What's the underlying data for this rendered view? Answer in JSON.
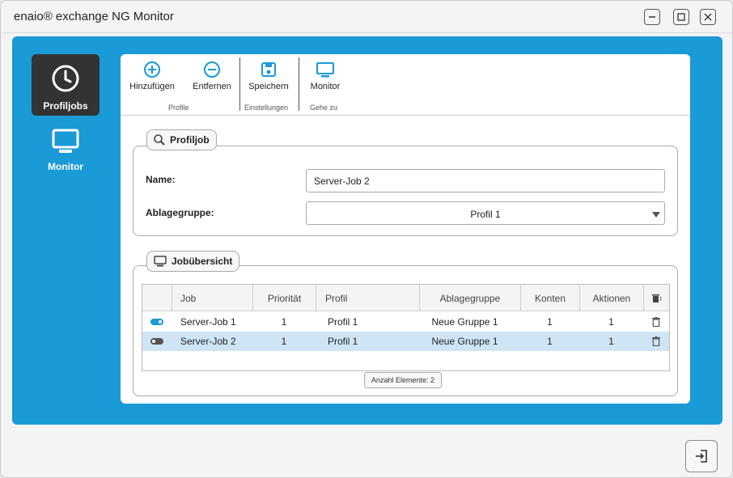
{
  "window": {
    "title": "enaio® exchange NG Monitor"
  },
  "colors": {
    "accent": "#1a9ad6",
    "nav_active": "#333333",
    "row_selected": "#cfe5f6"
  },
  "nav": [
    {
      "label": "Profiljobs",
      "icon": "clock-icon",
      "active": true
    },
    {
      "label": "Monitor",
      "icon": "monitor-icon",
      "active": false
    }
  ],
  "ribbon": {
    "buttons": [
      {
        "label": "Hinzufügen",
        "icon": "plus-circle-icon"
      },
      {
        "label": "Entfernen",
        "icon": "minus-circle-icon"
      },
      {
        "label": "Speichern",
        "icon": "save-icon"
      },
      {
        "label": "Monitor",
        "icon": "monitor-icon"
      }
    ],
    "groups": [
      "Profile",
      "Einstellungen",
      "Gehe zu"
    ]
  },
  "profiljob": {
    "title": "Profiljob",
    "name_label": "Name:",
    "name_value": "Server-Job 2",
    "ablagegruppe_label": "Ablagegruppe:",
    "ablagegruppe_value": "Profil 1"
  },
  "jobuebersicht": {
    "title": "Jobübersicht",
    "columns": [
      "Job",
      "Priorität",
      "Profil",
      "Ablagegruppe",
      "Konten",
      "Aktionen"
    ],
    "rows": [
      {
        "active": true,
        "job": "Server-Job 1",
        "prioritaet": "1",
        "profil": "Profil 1",
        "ablagegruppe": "Neue Gruppe 1",
        "konten": "1",
        "aktionen": "1",
        "selected": false
      },
      {
        "active": false,
        "job": "Server-Job 2",
        "prioritaet": "1",
        "profil": "Profil 1",
        "ablagegruppe": "Neue Gruppe 1",
        "konten": "1",
        "aktionen": "1",
        "selected": true
      }
    ],
    "count_label": "Anzahl Elemente: 2"
  },
  "footer": {
    "exit_icon": "exit-icon"
  }
}
